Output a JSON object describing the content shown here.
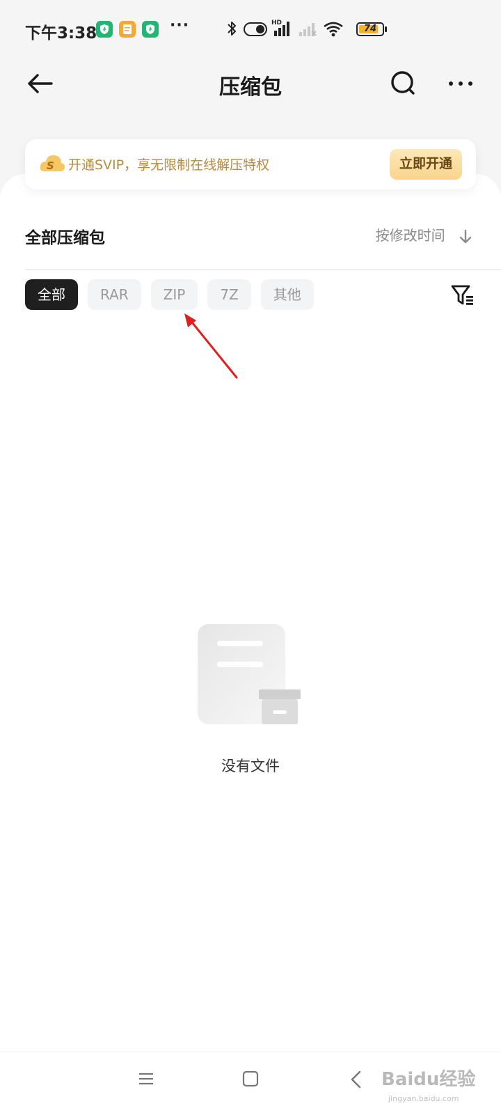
{
  "status_bar": {
    "time": "下午3:38",
    "more": "···",
    "battery_level": "74",
    "battery_fraction": 0.74
  },
  "header": {
    "title": "压缩包",
    "icons": [
      "back-arrow-icon",
      "search-icon",
      "more-icon"
    ]
  },
  "promo": {
    "text": "开通SVIP，享无限制在线解压特权",
    "button": "立即开通",
    "accent_color": "#b78a3e"
  },
  "list": {
    "section_title": "全部压缩包",
    "sort_label": "按修改时间"
  },
  "filters": {
    "chips": [
      "全部",
      "RAR",
      "ZIP",
      "7Z",
      "其他"
    ],
    "selected": "全部"
  },
  "empty_state": {
    "text": "没有文件"
  },
  "watermark": {
    "brand": "Baidu经验",
    "url": "jingyan.baidu.com"
  },
  "colors": {
    "annotation_arrow": "#e02020",
    "active_chip": "#1f1f1f",
    "chip_bg": "#f3f4f6"
  }
}
